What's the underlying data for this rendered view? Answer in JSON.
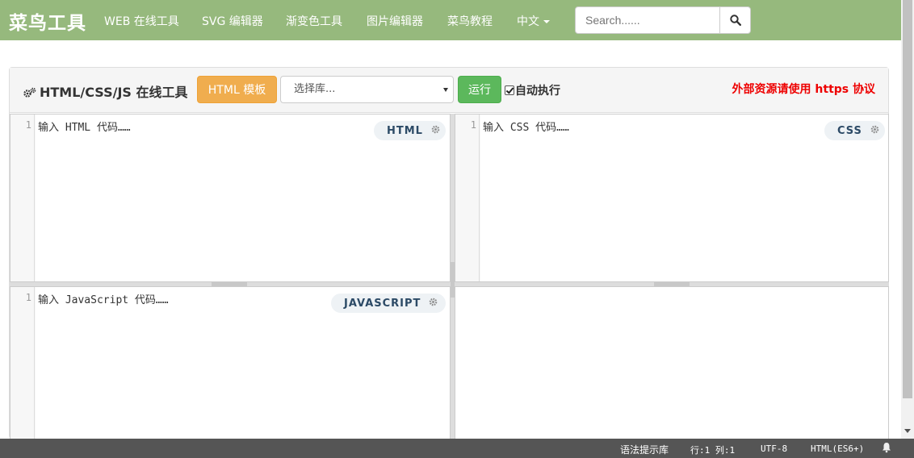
{
  "navbar": {
    "brand": "菜鸟工具",
    "items": [
      "WEB 在线工具",
      "SVG 编辑器",
      "渐变色工具",
      "图片编辑器",
      "菜鸟教程"
    ],
    "language": "中文",
    "search_placeholder": "Search......"
  },
  "toolbar": {
    "title": "HTML/CSS/JS 在线工具",
    "template_button": "HTML 模板",
    "library_select": "选择库...",
    "run_button": "运行",
    "auto_run_label": "自动执行",
    "auto_run_checked": true,
    "notice": "外部资源请使用 https 协议"
  },
  "editors": {
    "html": {
      "line": "1",
      "placeholder": "输入 HTML 代码……",
      "badge": "HTML"
    },
    "css": {
      "line": "1",
      "placeholder": "输入 CSS 代码……",
      "badge": "CSS"
    },
    "js": {
      "line": "1",
      "placeholder": "输入 JavaScript 代码……",
      "badge": "JAVASCRIPT"
    }
  },
  "statusbar": {
    "hint_lib": "语法提示库",
    "position": "行:1  列:1",
    "encoding": "UTF-8",
    "mode": "HTML(ES6+)"
  }
}
